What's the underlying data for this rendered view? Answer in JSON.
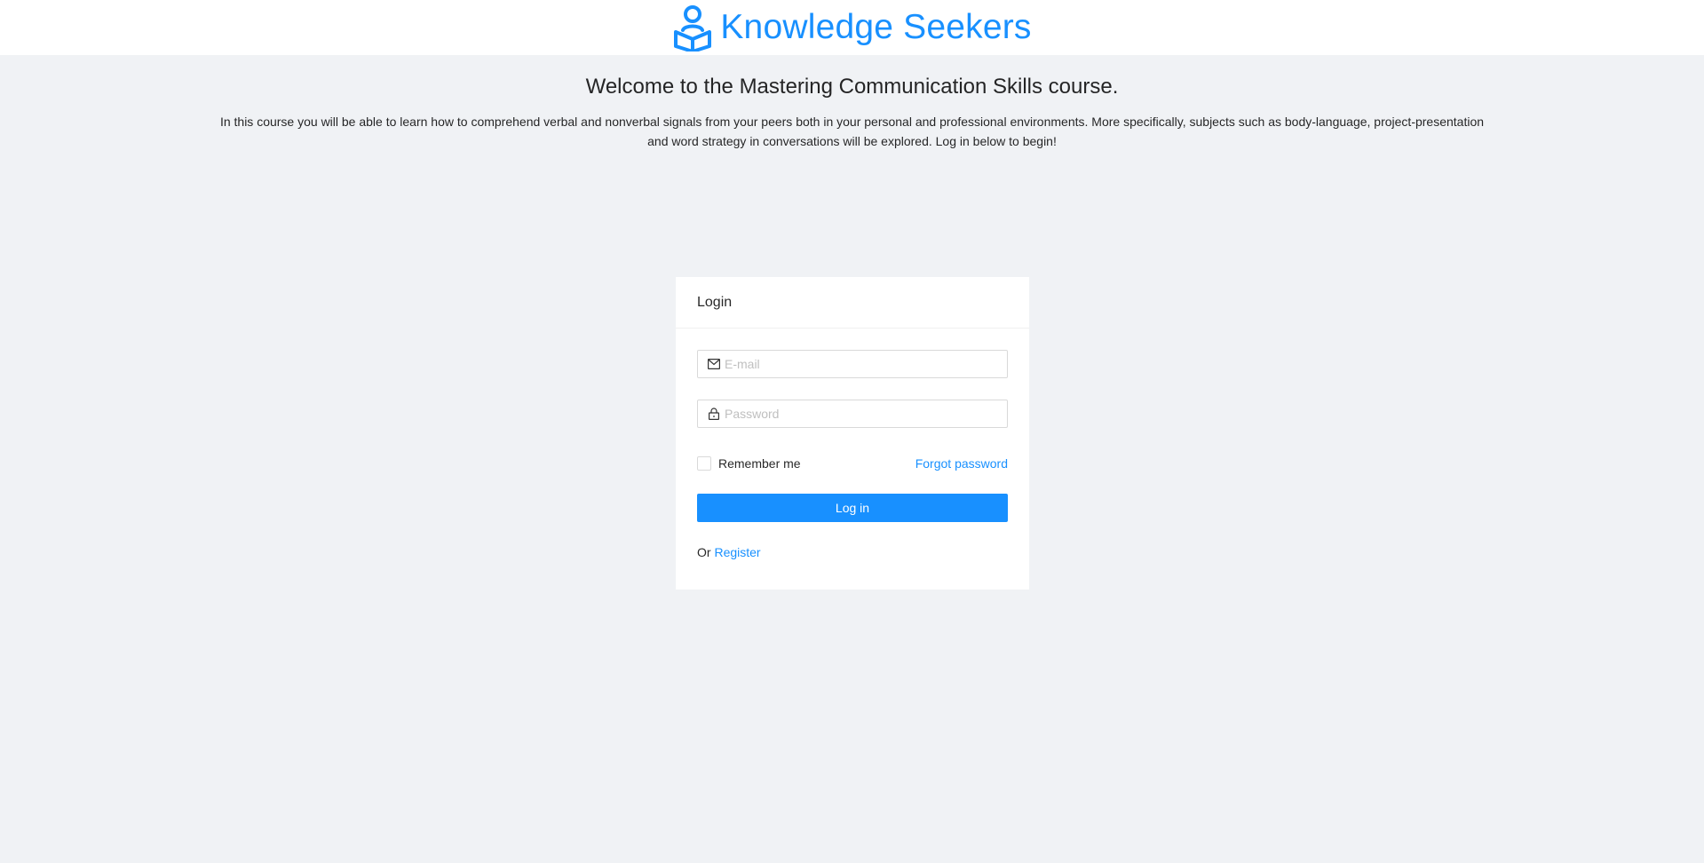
{
  "header": {
    "brand_name": "Knowledge Seekers",
    "logo_icon": "reader-book-icon",
    "brand_color": "#1890ff"
  },
  "intro": {
    "title": "Welcome to the Mastering Communication Skills course.",
    "description": "In this course you will be able to learn how to comprehend verbal and nonverbal signals from your peers both in your personal and professional environments. More specifically, subjects such as body-language, project-presentation and word strategy in conversations will be explored. Log in below to begin!"
  },
  "login": {
    "title": "Login",
    "email": {
      "placeholder": "E-mail",
      "value": "",
      "icon": "mail-icon"
    },
    "password": {
      "placeholder": "Password",
      "value": "",
      "icon": "lock-icon"
    },
    "remember_label": "Remember me",
    "remember_checked": false,
    "forgot_label": "Forgot password",
    "submit_label": "Log in",
    "register_prefix": "Or",
    "register_label": "Register"
  }
}
